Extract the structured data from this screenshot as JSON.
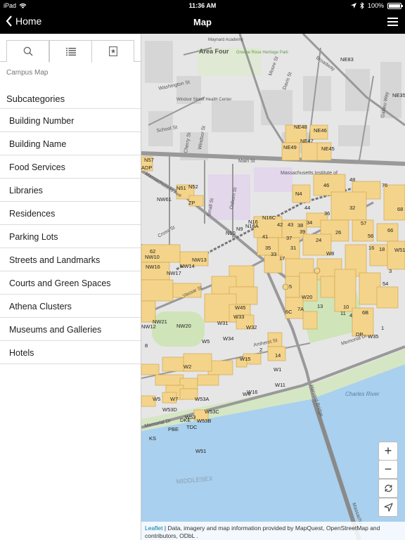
{
  "status_bar": {
    "device": "iPad",
    "time": "11:36 AM",
    "battery": "100%"
  },
  "nav": {
    "back_label": "Home",
    "title": "Map"
  },
  "sidebar": {
    "tabs": [
      {
        "icon": "search-icon"
      },
      {
        "icon": "list-icon"
      },
      {
        "icon": "bookmark-star-icon"
      }
    ],
    "breadcrumb": "Campus Map",
    "section_title": "Subcategories",
    "items": [
      "Building Number",
      "Building Name",
      "Food Services",
      "Libraries",
      "Residences",
      "Parking Lots",
      "Streets and Landmarks",
      "Courts and Green Spaces",
      "Athena Clusters",
      "Museums and Galleries",
      "Hotels"
    ]
  },
  "map": {
    "area_labels": {
      "area_four": "Area Four",
      "mit": "Massachusetts Institute of",
      "charles_river": "Charles River",
      "middlesex": "MIDDLESEX",
      "maynard": "Maynard Academy",
      "greene_rose": "Greene Rose Heritage Park",
      "windsor": "Windsor Street Health Center"
    },
    "street_labels": {
      "broadway": "Broadway",
      "davis": "Davis St",
      "moore": "Moore St",
      "main": "Main St",
      "mass_ave": "Massachusetts Ave",
      "vassar": "Vassar St",
      "amherst": "Amherst St",
      "memorial_east": "Memorial Dr",
      "memorial_west": "Memorial Dr",
      "harvard_bridge": "Harvard Bridge",
      "washington": "Washington St",
      "school": "School St",
      "windsor_st": "Windsor St",
      "cherry": "Cherry St",
      "osborn": "Osborn St",
      "small": "Small St",
      "cross": "Cross St",
      "galileo": "Galileo Way",
      "massachusetts_south": "Massachu"
    },
    "building_labels": [
      "NE83",
      "NE35",
      "NE48",
      "NE46",
      "NE49",
      "NE47",
      "NE45",
      "N57",
      "ADP",
      "N4",
      "46",
      "48",
      "76",
      "32",
      "68",
      "N51",
      "N52",
      "ZP",
      "NW61",
      "44",
      "36",
      "57",
      "N16",
      "N16C",
      "N16A",
      "N10",
      "N9",
      "42",
      "43",
      "38",
      "34",
      "26",
      "56",
      "66",
      "41",
      "37",
      "39",
      "24",
      "35",
      "33",
      "17",
      "31",
      "16",
      "18",
      "54",
      "62",
      "NW10",
      "NW16",
      "NW17",
      "NW14",
      "NW13",
      "NW12",
      "NW21",
      "NW20",
      "W45",
      "W31",
      "W33",
      "W32",
      "W20",
      "13",
      "10",
      "6C",
      "7A",
      "11",
      "4",
      "6B",
      "8",
      "W5",
      "W34",
      "W35",
      "1",
      "2",
      "14",
      "W15",
      "W11",
      "W16",
      "W1",
      "W4",
      "W2",
      "W5",
      "W7",
      "W53A",
      "W53D",
      "W53",
      "W53B",
      "W53C",
      "DKE",
      "PBE",
      "TDC",
      "KS",
      "W51",
      "W51C",
      "DP",
      "W8",
      "3",
      "5",
      "9",
      "12",
      "7"
    ]
  },
  "map_controls": {
    "zoom_in": "+",
    "zoom_out": "−"
  },
  "attribution": {
    "leaflet": "Leaflet",
    "text": " | Data, imagery and map information provided by MapQuest, OpenStreetMap and contributors, ODbL ."
  },
  "colors": {
    "building_fill": "#f4d48a",
    "building_stroke": "#c9a04a",
    "river": "#a9d0ee",
    "grass": "#cfe4b8",
    "road": "#9a9a9a",
    "link": "#0078a8"
  }
}
